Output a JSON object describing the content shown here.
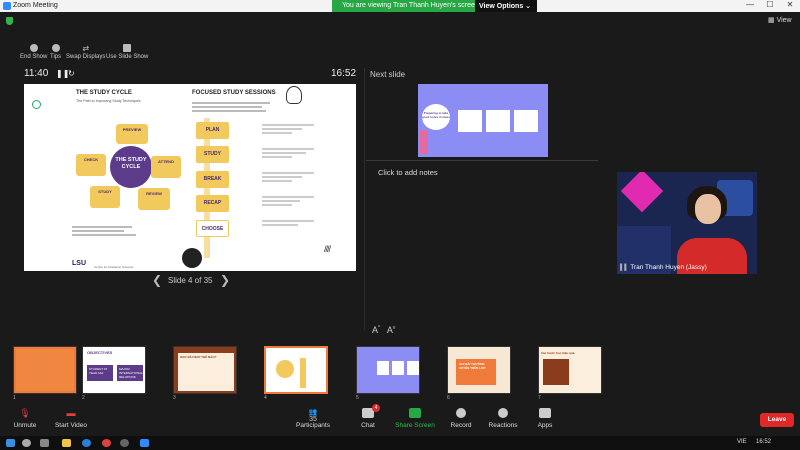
{
  "window": {
    "title": "Zoom Meeting",
    "min": "—",
    "max": "☐",
    "close": "✕"
  },
  "share_banner": {
    "text": "You are viewing Tran Thanh Huyen's screen",
    "view_options": "View Options ⌄"
  },
  "view_button": "View",
  "top_tools": [
    {
      "label": "End Show"
    },
    {
      "label": "Tips"
    },
    {
      "label": "Swap Displays"
    },
    {
      "label": "Use Slide Show"
    }
  ],
  "presenter": {
    "clock": "11:40",
    "elapsed": "16:52",
    "next_slide_label": "Next slide",
    "notes_placeholder": "Click to add notes",
    "slide_counter": "Slide 4 of 35",
    "prev_arrow": "❮",
    "next_arrow": "❯",
    "font_up": "A",
    "font_down": "A"
  },
  "slide": {
    "left_title": "THE STUDY CYCLE",
    "left_subtitle": "The Path to Improving Study Techniques",
    "center_title": "THE STUDY CYCLE",
    "cycle_steps": [
      "PREVIEW",
      "ATTEND",
      "REVIEW",
      "STUDY",
      "CHECK"
    ],
    "right_title": "FOCUSED STUDY SESSIONS",
    "session_steps": [
      "PLAN",
      "STUDY",
      "BREAK",
      "RECAP",
      "CHOOSE"
    ],
    "footer_logo": "LSU",
    "footer_sub": "Center for Academic Success"
  },
  "next_slide": {
    "title": "Preparing to take good notes in class"
  },
  "video": {
    "name": "Tran Thanh Huyen (Jassy)"
  },
  "thumbnails": [
    {
      "num": "1",
      "text": ""
    },
    {
      "num": "2",
      "text": "OBJECTIVES"
    },
    {
      "num": "3",
      "text": "HỌC BÀI NHƯ THẾ NÀO?"
    },
    {
      "num": "4",
      "text": ""
    },
    {
      "num": "5",
      "text": ""
    },
    {
      "num": "6",
      "text": "GHI BÀI THƯỜNG XUYÊN TRÊN LỚP"
    },
    {
      "num": "7",
      "text": "Các bước học hiệu quả"
    }
  ],
  "thumb2": {
    "box1": "STUDENT AT YEAR 1&2",
    "box2": "MAJOR: INTERNATIONAL RELATIONS"
  },
  "toolbar": {
    "unmute": "Unmute",
    "start_video": "Start Video",
    "participants": "Participants",
    "participants_count": "35",
    "chat": "Chat",
    "chat_badge": "4",
    "share_screen": "Share Screen",
    "record": "Record",
    "reactions": "Reactions",
    "apps": "Apps",
    "leave": "Leave"
  },
  "taskbar": {
    "lang": "VIE",
    "time": "16:52"
  },
  "colors": {
    "accent_green": "#27a844",
    "leave_red": "#e02828",
    "zoom_blue": "#2d8cff",
    "slide_purple": "#6b4b9a",
    "slide_yellow": "#f2c95c"
  }
}
